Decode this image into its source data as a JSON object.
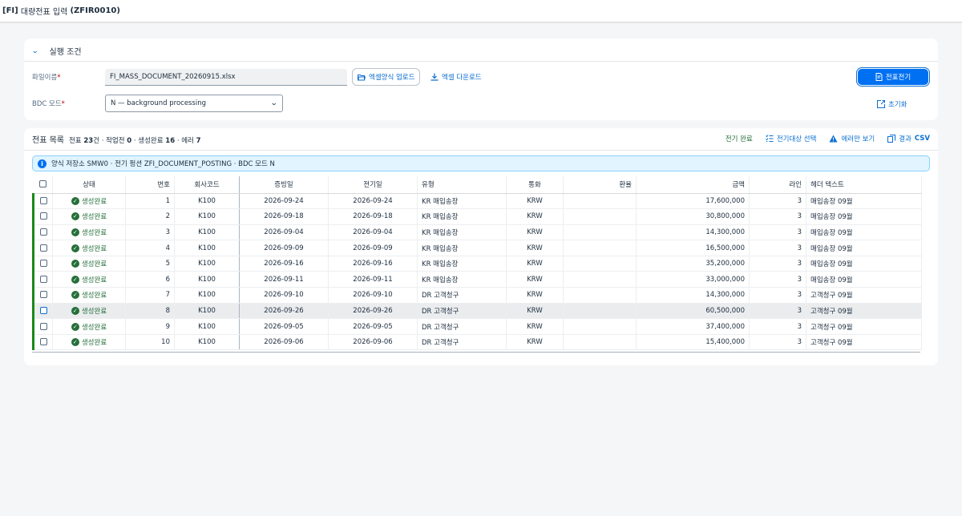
{
  "app": {
    "prefix": "[FI]",
    "title": "대량전표 입력",
    "code": "(ZFIR0010)"
  },
  "conditions": {
    "header": "실행 조건",
    "file_label": "파일이름",
    "file_value": "FI_MASS_DOCUMENT_20260915.xlsx",
    "upload_label": "엑셀양식 업로드",
    "download_label": "엑셀 다운로드",
    "bdc_label": "BDC 모드",
    "bdc_value": "N — background processing",
    "post_button": "전표전기",
    "reset_label": "초기화"
  },
  "list": {
    "title": "전표 목록",
    "summary_prefix": "전표",
    "total": "23",
    "total_unit": "건 · 작업전",
    "pending": "0",
    "done_label": "· 생성완료",
    "done": "16",
    "error_label": "· 에러",
    "errors": "7",
    "toolbar": {
      "posting_done": "전기 완료",
      "select_targets": "전기대상 선택",
      "errors_only": "에러만 보기",
      "result_csv_prefix": "결과",
      "result_csv_suffix": "CSV"
    },
    "info": "양식 저장소 SMW0 · 전기 펑션 ZFI_DOCUMENT_POSTING · BDC 모드 N",
    "columns": [
      "상태",
      "번호",
      "회사코드",
      "증빙일",
      "전기일",
      "유형",
      "통화",
      "환율",
      "금액",
      "라인",
      "헤더 텍스트"
    ],
    "rows": [
      {
        "status": "생성완료",
        "no": "1",
        "company": "K100",
        "doc_date": "2026-09-24",
        "post_date": "2026-09-24",
        "type": "KR 매입송장",
        "currency": "KRW",
        "rate": "",
        "amount": "17,600,000",
        "lines": "3",
        "text": "매입송장 09월"
      },
      {
        "status": "생성완료",
        "no": "2",
        "company": "K100",
        "doc_date": "2026-09-18",
        "post_date": "2026-09-18",
        "type": "KR 매입송장",
        "currency": "KRW",
        "rate": "",
        "amount": "30,800,000",
        "lines": "3",
        "text": "매입송장 09월"
      },
      {
        "status": "생성완료",
        "no": "3",
        "company": "K100",
        "doc_date": "2026-09-04",
        "post_date": "2026-09-04",
        "type": "KR 매입송장",
        "currency": "KRW",
        "rate": "",
        "amount": "14,300,000",
        "lines": "3",
        "text": "매입송장 09월"
      },
      {
        "status": "생성완료",
        "no": "4",
        "company": "K100",
        "doc_date": "2026-09-09",
        "post_date": "2026-09-09",
        "type": "KR 매입송장",
        "currency": "KRW",
        "rate": "",
        "amount": "16,500,000",
        "lines": "3",
        "text": "매입송장 09월"
      },
      {
        "status": "생성완료",
        "no": "5",
        "company": "K100",
        "doc_date": "2026-09-16",
        "post_date": "2026-09-16",
        "type": "KR 매입송장",
        "currency": "KRW",
        "rate": "",
        "amount": "35,200,000",
        "lines": "3",
        "text": "매입송장 09월"
      },
      {
        "status": "생성완료",
        "no": "6",
        "company": "K100",
        "doc_date": "2026-09-11",
        "post_date": "2026-09-11",
        "type": "KR 매입송장",
        "currency": "KRW",
        "rate": "",
        "amount": "33,000,000",
        "lines": "3",
        "text": "매입송장 09월"
      },
      {
        "status": "생성완료",
        "no": "7",
        "company": "K100",
        "doc_date": "2026-09-10",
        "post_date": "2026-09-10",
        "type": "DR 고객청구",
        "currency": "KRW",
        "rate": "",
        "amount": "14,300,000",
        "lines": "3",
        "text": "고객청구 09월"
      },
      {
        "status": "생성완료",
        "no": "8",
        "company": "K100",
        "doc_date": "2026-09-26",
        "post_date": "2026-09-26",
        "type": "DR 고객청구",
        "currency": "KRW",
        "rate": "",
        "amount": "60,500,000",
        "lines": "3",
        "text": "고객청구 09월"
      },
      {
        "status": "생성완료",
        "no": "9",
        "company": "K100",
        "doc_date": "2026-09-05",
        "post_date": "2026-09-05",
        "type": "DR 고객청구",
        "currency": "KRW",
        "rate": "",
        "amount": "37,400,000",
        "lines": "3",
        "text": "고객청구 09월"
      },
      {
        "status": "생성완료",
        "no": "10",
        "company": "K100",
        "doc_date": "2026-09-06",
        "post_date": "2026-09-06",
        "type": "DR 고객청구",
        "currency": "KRW",
        "rate": "",
        "amount": "15,400,000",
        "lines": "3",
        "text": "고객청구 09월"
      }
    ]
  },
  "colors": {
    "accent": "#0a6ed1",
    "primary_button": "#0070f2",
    "success": "#256f3a",
    "row_indicator": "#188918",
    "info_bg": "#e1f4ff"
  }
}
